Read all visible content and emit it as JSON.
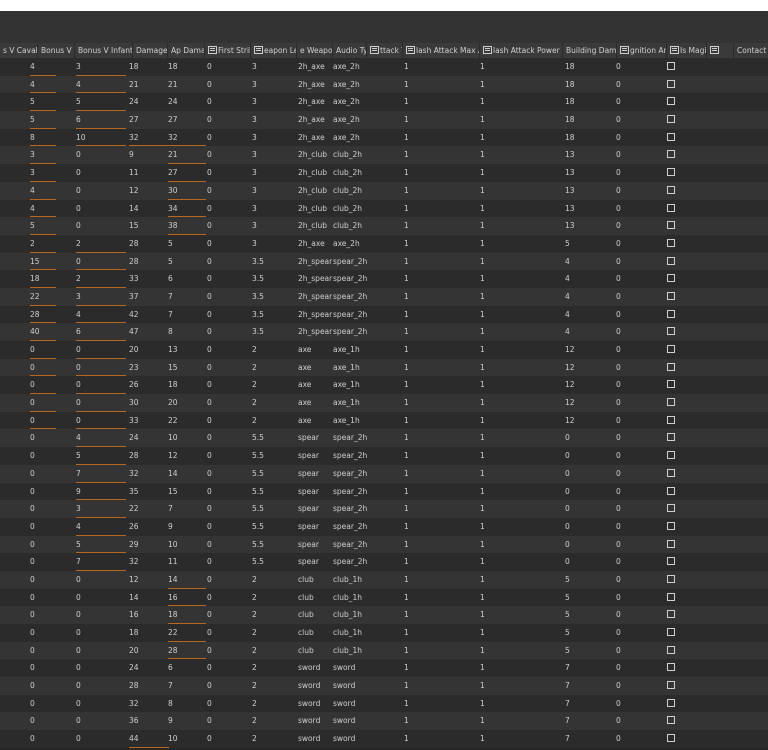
{
  "columns": [
    {
      "label": "s V Cavalr",
      "icon": false
    },
    {
      "label": "Bonus V Larg",
      "icon": false
    },
    {
      "label": "Bonus V Infantry",
      "icon": false
    },
    {
      "label": "Damage",
      "icon": false
    },
    {
      "label": "Ap Damage",
      "icon": false
    },
    {
      "label": "First Strike",
      "icon": true
    },
    {
      "label": "eapon Lengt",
      "icon": true
    },
    {
      "label": "e Weapon T",
      "icon": false
    },
    {
      "label": "Audio Type",
      "icon": false
    },
    {
      "label": "ttack Ta",
      "icon": true
    },
    {
      "label": "lash Attack Max Attac",
      "icon": true
    },
    {
      "label": "lash Attack Power Multipli",
      "icon": true
    },
    {
      "label": "Building Damage",
      "icon": false
    },
    {
      "label": "gnition Amou",
      "icon": true
    },
    {
      "label": "Is Magical",
      "icon": true
    },
    {
      "label": "",
      "icon": true
    },
    {
      "label": "Contact Pha",
      "icon": false
    }
  ],
  "rows": [
    [
      "4",
      "3",
      "18",
      "18",
      "0",
      "3",
      "2h_axe",
      "axe_2h",
      "1",
      "1",
      "18",
      "0"
    ],
    [
      "4",
      "4",
      "21",
      "21",
      "0",
      "3",
      "2h_axe",
      "axe_2h",
      "1",
      "1",
      "18",
      "0"
    ],
    [
      "5",
      "5",
      "24",
      "24",
      "0",
      "3",
      "2h_axe",
      "axe_2h",
      "1",
      "1",
      "18",
      "0"
    ],
    [
      "5",
      "6",
      "27",
      "27",
      "0",
      "3",
      "2h_axe",
      "axe_2h",
      "1",
      "1",
      "18",
      "0"
    ],
    [
      "8",
      "10",
      "32",
      "32",
      "0",
      "3",
      "2h_axe",
      "axe_2h",
      "1",
      "1",
      "18",
      "0"
    ],
    [
      "3",
      "0",
      "9",
      "21",
      "0",
      "3",
      "2h_club",
      "club_2h",
      "1",
      "1",
      "13",
      "0"
    ],
    [
      "3",
      "0",
      "11",
      "27",
      "0",
      "3",
      "2h_club",
      "club_2h",
      "1",
      "1",
      "13",
      "0"
    ],
    [
      "4",
      "0",
      "12",
      "30",
      "0",
      "3",
      "2h_club",
      "club_2h",
      "1",
      "1",
      "13",
      "0"
    ],
    [
      "4",
      "0",
      "14",
      "34",
      "0",
      "3",
      "2h_club",
      "club_2h",
      "1",
      "1",
      "13",
      "0"
    ],
    [
      "5",
      "0",
      "15",
      "38",
      "0",
      "3",
      "2h_club",
      "club_2h",
      "1",
      "1",
      "13",
      "0"
    ],
    [
      "2",
      "2",
      "28",
      "5",
      "0",
      "3",
      "2h_axe",
      "axe_2h",
      "1",
      "1",
      "5",
      "0"
    ],
    [
      "15",
      "0",
      "28",
      "5",
      "0",
      "3.5",
      "2h_spear",
      "spear_2h",
      "1",
      "1",
      "4",
      "0"
    ],
    [
      "18",
      "2",
      "33",
      "6",
      "0",
      "3.5",
      "2h_spear",
      "spear_2h",
      "1",
      "1",
      "4",
      "0"
    ],
    [
      "22",
      "3",
      "37",
      "7",
      "0",
      "3.5",
      "2h_spear",
      "spear_2h",
      "1",
      "1",
      "4",
      "0"
    ],
    [
      "28",
      "4",
      "42",
      "7",
      "0",
      "3.5",
      "2h_spear",
      "spear_2h",
      "1",
      "1",
      "4",
      "0"
    ],
    [
      "40",
      "6",
      "47",
      "8",
      "0",
      "3.5",
      "2h_spear",
      "spear_2h",
      "1",
      "1",
      "4",
      "0"
    ],
    [
      "0",
      "0",
      "20",
      "13",
      "0",
      "2",
      "axe",
      "axe_1h",
      "1",
      "1",
      "12",
      "0"
    ],
    [
      "0",
      "0",
      "23",
      "15",
      "0",
      "2",
      "axe",
      "axe_1h",
      "1",
      "1",
      "12",
      "0"
    ],
    [
      "0",
      "0",
      "26",
      "18",
      "0",
      "2",
      "axe",
      "axe_1h",
      "1",
      "1",
      "12",
      "0"
    ],
    [
      "0",
      "0",
      "30",
      "20",
      "0",
      "2",
      "axe",
      "axe_1h",
      "1",
      "1",
      "12",
      "0"
    ],
    [
      "0",
      "0",
      "33",
      "22",
      "0",
      "2",
      "axe",
      "axe_1h",
      "1",
      "1",
      "12",
      "0"
    ],
    [
      "0",
      "4",
      "24",
      "10",
      "0",
      "5.5",
      "spear",
      "spear_2h",
      "1",
      "1",
      "0",
      "0"
    ],
    [
      "0",
      "5",
      "28",
      "12",
      "0",
      "5.5",
      "spear",
      "spear_2h",
      "1",
      "1",
      "0",
      "0"
    ],
    [
      "0",
      "7",
      "32",
      "14",
      "0",
      "5.5",
      "spear",
      "spear_2h",
      "1",
      "1",
      "0",
      "0"
    ],
    [
      "0",
      "9",
      "35",
      "15",
      "0",
      "5.5",
      "spear",
      "spear_2h",
      "1",
      "1",
      "0",
      "0"
    ],
    [
      "0",
      "3",
      "22",
      "7",
      "0",
      "5.5",
      "spear",
      "spear_2h",
      "1",
      "1",
      "0",
      "0"
    ],
    [
      "0",
      "4",
      "26",
      "9",
      "0",
      "5.5",
      "spear",
      "spear_2h",
      "1",
      "1",
      "0",
      "0"
    ],
    [
      "0",
      "5",
      "29",
      "10",
      "0",
      "5.5",
      "spear",
      "spear_2h",
      "1",
      "1",
      "0",
      "0"
    ],
    [
      "0",
      "7",
      "32",
      "11",
      "0",
      "5.5",
      "spear",
      "spear_2h",
      "1",
      "1",
      "0",
      "0"
    ],
    [
      "0",
      "0",
      "12",
      "14",
      "0",
      "2",
      "club",
      "club_1h",
      "1",
      "1",
      "5",
      "0"
    ],
    [
      "0",
      "0",
      "14",
      "16",
      "0",
      "2",
      "club",
      "club_1h",
      "1",
      "1",
      "5",
      "0"
    ],
    [
      "0",
      "0",
      "16",
      "18",
      "0",
      "2",
      "club",
      "club_1h",
      "1",
      "1",
      "5",
      "0"
    ],
    [
      "0",
      "0",
      "18",
      "22",
      "0",
      "2",
      "club",
      "club_1h",
      "1",
      "1",
      "5",
      "0"
    ],
    [
      "0",
      "0",
      "20",
      "28",
      "0",
      "2",
      "club",
      "club_1h",
      "1",
      "1",
      "5",
      "0"
    ],
    [
      "0",
      "0",
      "24",
      "6",
      "0",
      "2",
      "sword",
      "sword",
      "1",
      "1",
      "7",
      "0"
    ],
    [
      "0",
      "0",
      "28",
      "7",
      "0",
      "2",
      "sword",
      "sword",
      "1",
      "1",
      "7",
      "0"
    ],
    [
      "0",
      "0",
      "32",
      "8",
      "0",
      "2",
      "sword",
      "sword",
      "1",
      "1",
      "7",
      "0"
    ],
    [
      "0",
      "0",
      "36",
      "9",
      "0",
      "2",
      "sword",
      "sword",
      "1",
      "1",
      "7",
      "0"
    ],
    [
      "0",
      "0",
      "44",
      "10",
      "0",
      "2",
      "sword",
      "sword",
      "1",
      "1",
      "7",
      "0"
    ]
  ],
  "modified_cells": [
    [
      0,
      0
    ],
    [
      0,
      1
    ],
    [
      1,
      0
    ],
    [
      1,
      1
    ],
    [
      2,
      0
    ],
    [
      2,
      1
    ],
    [
      3,
      0
    ],
    [
      3,
      1
    ],
    [
      4,
      0
    ],
    [
      4,
      1
    ],
    [
      4,
      2
    ],
    [
      4,
      3
    ],
    [
      5,
      0
    ],
    [
      5,
      3
    ],
    [
      6,
      0
    ],
    [
      6,
      3
    ],
    [
      7,
      0
    ],
    [
      7,
      3
    ],
    [
      8,
      0
    ],
    [
      8,
      3
    ],
    [
      9,
      0
    ],
    [
      9,
      3
    ],
    [
      10,
      0
    ],
    [
      10,
      1
    ],
    [
      11,
      0
    ],
    [
      11,
      1
    ],
    [
      12,
      0
    ],
    [
      12,
      1
    ],
    [
      13,
      0
    ],
    [
      13,
      1
    ],
    [
      14,
      0
    ],
    [
      14,
      1
    ],
    [
      15,
      0
    ],
    [
      15,
      1
    ],
    [
      16,
      0
    ],
    [
      16,
      1
    ],
    [
      17,
      0
    ],
    [
      17,
      1
    ],
    [
      18,
      0
    ],
    [
      18,
      1
    ],
    [
      19,
      0
    ],
    [
      19,
      1
    ],
    [
      20,
      0
    ],
    [
      20,
      1
    ],
    [
      21,
      1
    ],
    [
      22,
      1
    ],
    [
      23,
      1
    ],
    [
      24,
      1
    ],
    [
      25,
      1
    ],
    [
      26,
      1
    ],
    [
      27,
      1
    ],
    [
      28,
      1
    ],
    [
      29,
      3
    ],
    [
      30,
      3
    ],
    [
      31,
      3
    ],
    [
      32,
      3
    ],
    [
      33,
      3
    ],
    [
      38,
      2
    ]
  ],
  "colors": {
    "modified_underline": "#b8681c"
  },
  "is_magical_checked": false
}
